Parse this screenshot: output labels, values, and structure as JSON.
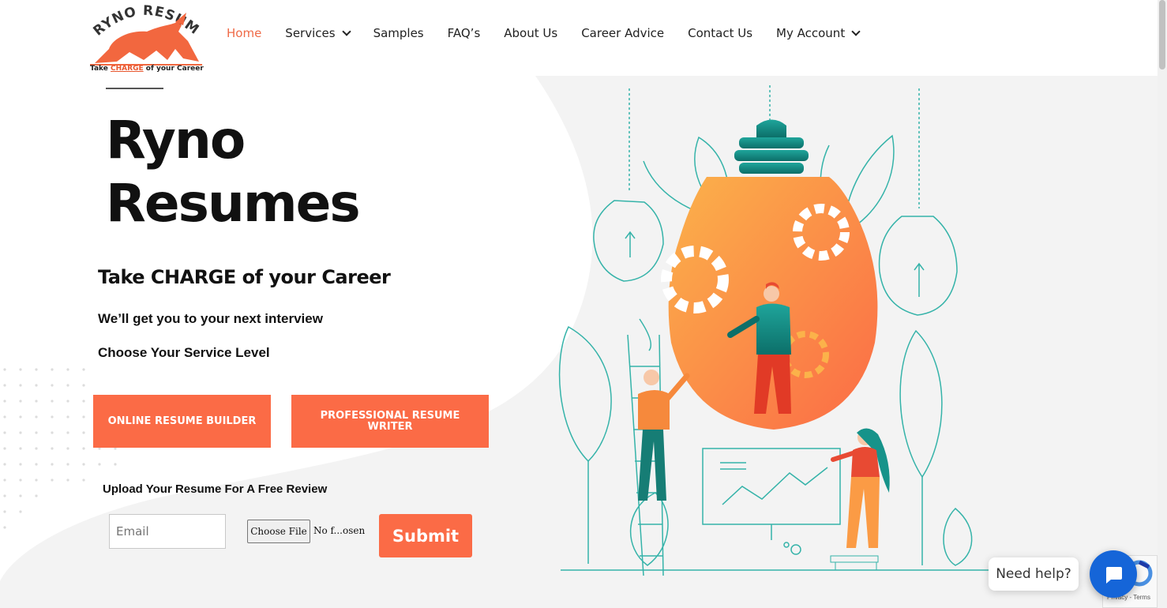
{
  "brand": {
    "logo_text": "RYNO RESUMES",
    "logo_tagline_prefix": "Take ",
    "logo_tagline_highlight": "CHARGE",
    "logo_tagline_suffix": " of your Career",
    "accent_color": "#fb6b46"
  },
  "nav": {
    "items": [
      {
        "label": "Home",
        "active": true
      },
      {
        "label": "Services",
        "dropdown": true
      },
      {
        "label": "Samples"
      },
      {
        "label": "FAQ’s"
      },
      {
        "label": "About Us"
      },
      {
        "label": "Career Advice"
      },
      {
        "label": "Contact Us"
      },
      {
        "label": "My Account",
        "dropdown": true
      }
    ]
  },
  "hero": {
    "title_line1": "Ryno",
    "title_line2": "Resumes",
    "subtitle": "Take CHARGE of your Career",
    "tagline": "We’ll get you to your next interview",
    "choose_label": "Choose Your Service Level",
    "btn_online": "ONLINE RESUME BUILDER",
    "btn_professional": "PROFESSIONAL RESUME WRITER"
  },
  "upload": {
    "label": "Upload Your Resume For A Free Review",
    "email_placeholder": "Email",
    "file_button": "Choose File",
    "file_status": "No f...osen",
    "submit": "Submit"
  },
  "chat": {
    "help_text": "Need help?",
    "icon": "chat-bubble-icon"
  },
  "recaptcha": {
    "text": "Privacy - Terms"
  }
}
